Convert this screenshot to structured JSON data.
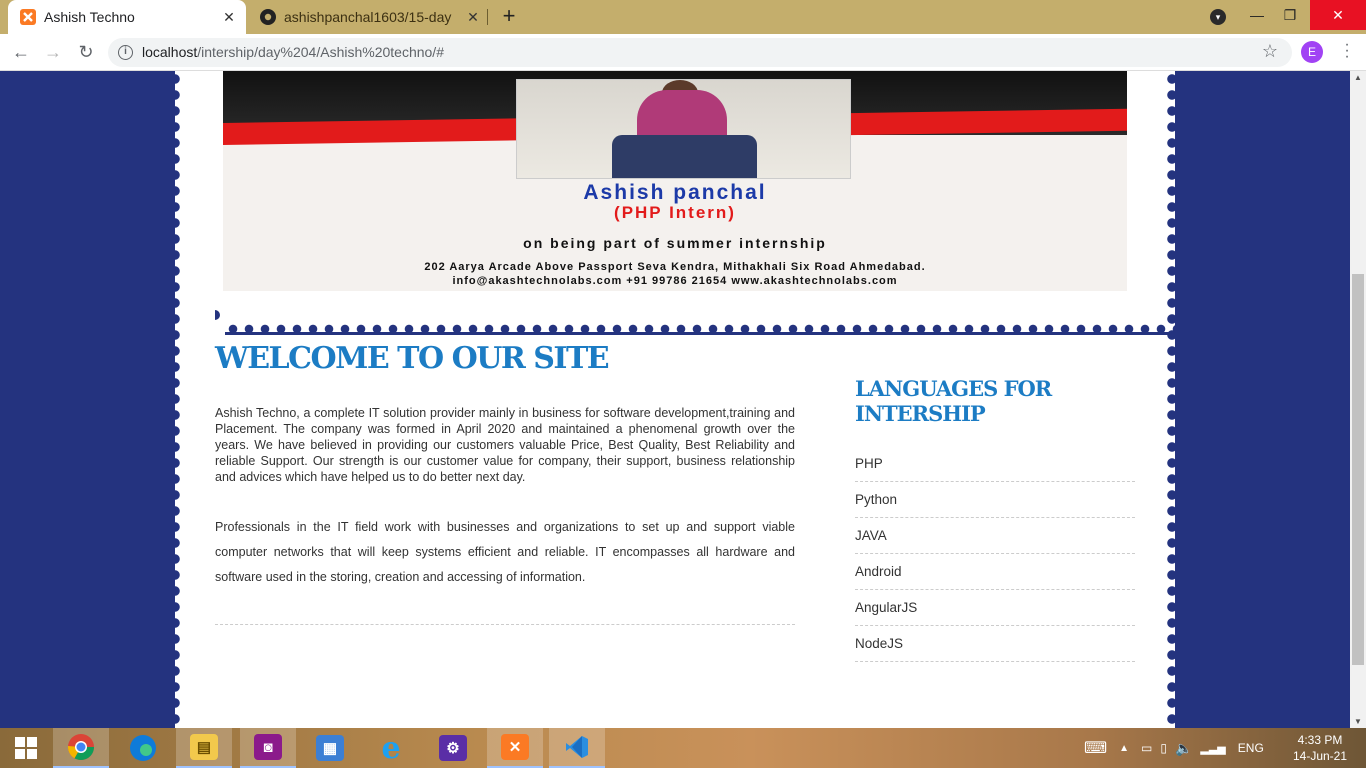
{
  "browser": {
    "tabs": [
      {
        "title": "Ashish Techno",
        "active": true,
        "icon": "xampp-icon"
      },
      {
        "title": "ashishpanchal1603/15-day",
        "active": false,
        "icon": "github-icon"
      }
    ],
    "url_host": "localhost",
    "url_path": "/intership/day%204/Ashish%20techno/#",
    "profile_initial": "E"
  },
  "banner": {
    "name": "Ashish panchal",
    "role": "(PHP Intern)",
    "tagline": "on being part of summer internship",
    "address": "202 Aarya Arcade Above Passport Seva Kendra, Mithakhali Six Road Ahmedabad.",
    "contact": "info@akashtechnolabs.com  +91 99786 21654  www.akashtechnolabs.com"
  },
  "main": {
    "heading": "WELCOME TO OUR SITE",
    "paragraph1": "Ashish Techno, a complete IT solution provider mainly in business for software development,training and Placement. The company was formed in April 2020 and maintained a phenomenal growth over the years. We have believed in providing our customers valuable Price, Best Quality, Best Reliability and reliable Support. Our strength is our customer value for company, their support, business relationship and advices which have helped us to do better next day.",
    "paragraph2": "Professionals in the IT field work with businesses and organizations to set up and support viable computer networks that will keep systems efficient and reliable. IT encompasses all hardware and software used in the storing, creation and accessing of information."
  },
  "sidebar": {
    "title": "LANGUAGES FOR INTERSHIP",
    "languages": [
      "PHP",
      "Python",
      "JAVA",
      "Android",
      "AngularJS",
      "NodeJS"
    ]
  },
  "taskbar": {
    "language": "ENG",
    "time": "4:33 PM",
    "date": "14-Jun-21"
  },
  "colors": {
    "page_bg": "#24337f",
    "heading_blue": "#1c7cc4",
    "banner_red": "#e21b1b",
    "tab_strip": "#c4ae6c"
  }
}
